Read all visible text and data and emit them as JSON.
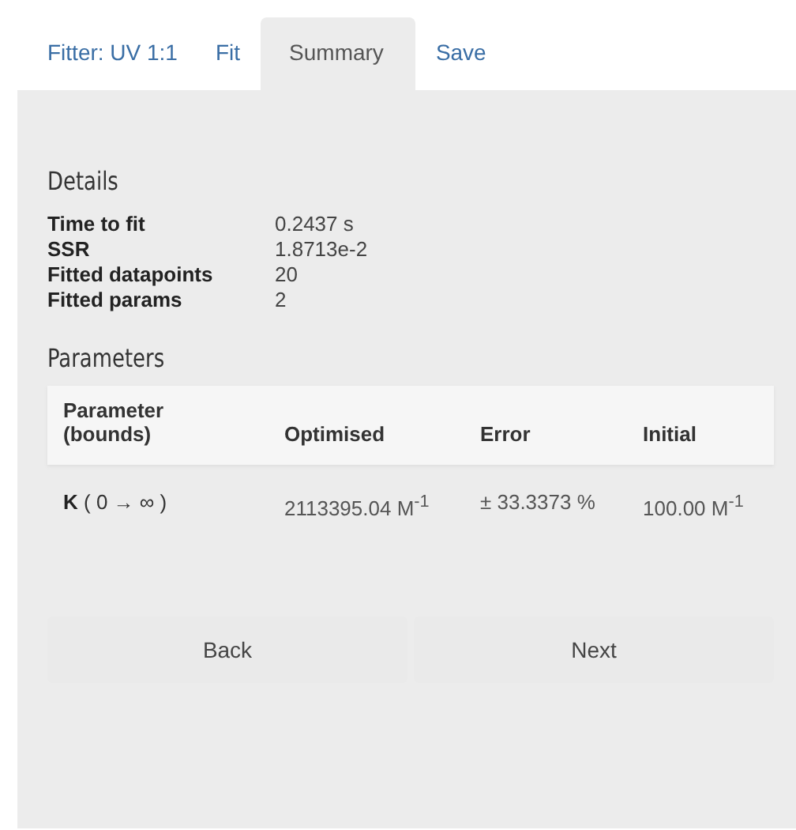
{
  "tabs": [
    {
      "label": "Fitter: UV 1:1",
      "selected": false
    },
    {
      "label": "Fit",
      "selected": false
    },
    {
      "label": "Summary",
      "selected": true
    },
    {
      "label": "Save",
      "selected": false
    }
  ],
  "details": {
    "title": "Details",
    "rows": [
      {
        "label": "Time to fit",
        "value": "0.2437 s"
      },
      {
        "label": "SSR",
        "value": "1.8713e-2"
      },
      {
        "label": "Fitted datapoints",
        "value": "20"
      },
      {
        "label": "Fitted params",
        "value": "2"
      }
    ]
  },
  "parameters": {
    "title": "Parameters",
    "columns": [
      "Parameter (bounds)",
      "Optimised",
      "Error",
      "Initial"
    ],
    "rows": [
      [
        "**K** ( 0 → ∞ )",
        "2113395.04 M$^{-1}$",
        "± 33.3373 %",
        "100.00 M$^{-1}$"
      ]
    ]
  },
  "buttons": [
    "Back",
    "Next"
  ]
}
